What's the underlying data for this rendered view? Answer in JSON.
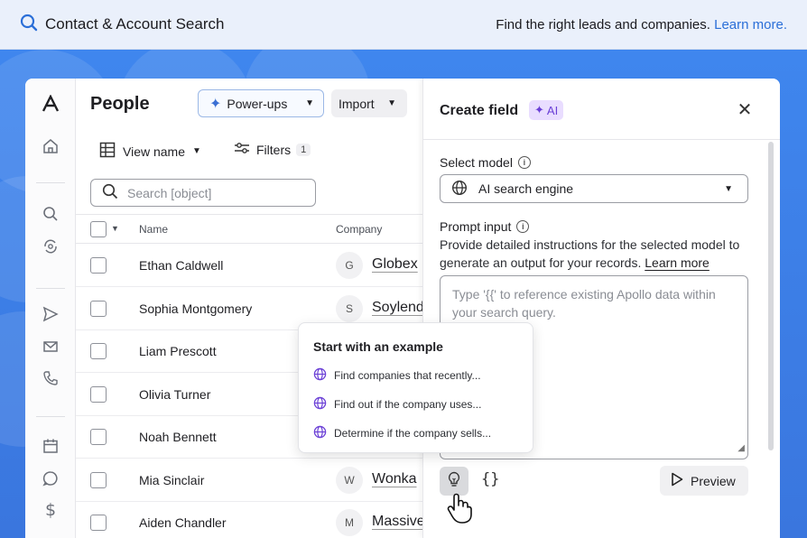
{
  "banner": {
    "title": "Contact & Account Search",
    "tagline": "Find the right leads and companies.",
    "learn_more": "Learn more."
  },
  "people": {
    "title": "People",
    "power_ups": "Power-ups",
    "import": "Import",
    "view_name": "View name",
    "filters": "Filters",
    "filters_count": "1",
    "search_placeholder": "Search [object]",
    "columns": {
      "name": "Name",
      "company": "Company"
    },
    "rows": [
      {
        "name": "Ethan Caldwell",
        "initial": "G",
        "company": "Globex"
      },
      {
        "name": "Sophia Montgomery",
        "initial": "S",
        "company": "Soylend"
      },
      {
        "name": "Liam Prescott",
        "initial": "",
        "company": ""
      },
      {
        "name": "Olivia Turner",
        "initial": "",
        "company": ""
      },
      {
        "name": "Noah Bennett",
        "initial": "",
        "company": ""
      },
      {
        "name": "Mia Sinclair",
        "initial": "W",
        "company": "Wonka"
      },
      {
        "name": "Aiden Chandler",
        "initial": "M",
        "company": "Massive"
      }
    ]
  },
  "create_field": {
    "title": "Create field",
    "ai_badge": "AI",
    "select_model_label": "Select model",
    "model_value": "AI search engine",
    "prompt_label": "Prompt input",
    "prompt_desc": "Provide detailed instructions for the selected model to generate an output for your records.",
    "prompt_learn_more": "Learn more",
    "prompt_placeholder": "Type '{{' to reference existing Apollo data within your search query.",
    "braces": "{}",
    "preview": "Preview"
  },
  "examples": {
    "title": "Start with an example",
    "items": [
      "Find companies that recently...",
      "Find out if the company uses...",
      "Determine if the company sells..."
    ]
  },
  "colors": {
    "accent": "#3d7ee8",
    "ai_purple": "#6a3fd6",
    "link_blue": "#2b6fd8"
  }
}
